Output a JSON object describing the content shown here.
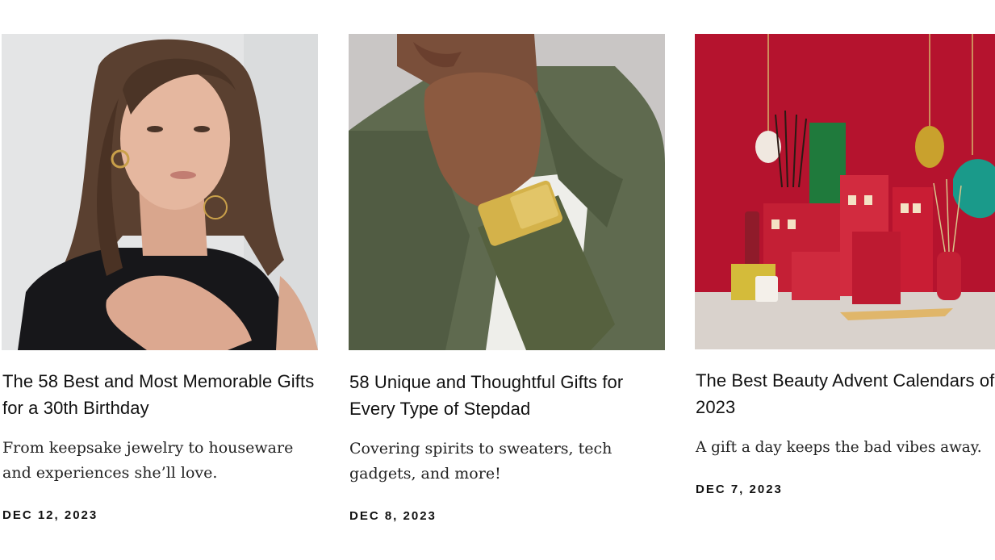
{
  "articles": [
    {
      "image": "woman-with-gold-hoop-earrings-photo",
      "title": "The 58 Best and Most Memorable Gifts for a 30th Birthday",
      "dek": "From keepsake jewelry to houseware and experiences she’ll love.",
      "date": "DEC 12, 2023"
    },
    {
      "image": "man-wearing-gold-watch-photo",
      "title": "58 Unique and Thoughtful Gifts for Every Type of Stepdad",
      "dek": "Covering spirits to sweaters, tech gadgets, and more!",
      "date": "DEC 8, 2023"
    },
    {
      "image": "holiday-beauty-advent-calendars-photo",
      "title": "The Best Beauty Advent Calendars of 2023",
      "dek": "A gift a day keeps the bad vibes away.",
      "date": "DEC 7, 2023"
    }
  ],
  "colors": {
    "background": "#ffffff",
    "text": "#111111",
    "card3_backdrop": "#b5132e"
  }
}
